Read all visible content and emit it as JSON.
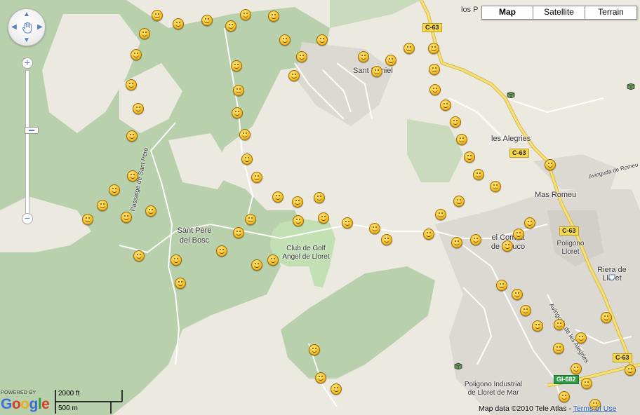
{
  "map_type": {
    "buttons": [
      {
        "label": "Map",
        "active": true
      },
      {
        "label": "Satellite",
        "active": false
      },
      {
        "label": "Terrain",
        "active": false
      }
    ]
  },
  "controls": {
    "zoom_in": "+",
    "zoom_out": "−",
    "pan": {
      "up": "▲",
      "down": "▼",
      "left": "◀",
      "right": "▶"
    }
  },
  "places": {
    "los_p": "los P",
    "sant_daniel": "Sant Daniel",
    "les_alegries": "les Alegries",
    "mas_romeu": "Mas Romeu",
    "sant_pere_1": "Sant Pere",
    "sant_pere_2": "del Bosc",
    "golf_1": "Club de Golf",
    "golf_2": "Angel de Lloret",
    "comtat_1": "el Comtat",
    "comtat_2": "de Jaruco",
    "poligono_lloret_1": "Poligono",
    "poligono_lloret_2": "Lloret",
    "riera_1": "Riera de",
    "riera_2": "Lloret",
    "poligono_ind_1": "Poligono Industrial",
    "poligono_ind_2": "de Lloret de Mar",
    "passatge": "Passatge de Sant Pere",
    "avinguda_romeu": "Avinguda de Romeu",
    "avinguda_alegries": "Avinguda de les Alegries"
  },
  "roads": {
    "c63": "C-63",
    "gi682": "GI-682"
  },
  "branding": {
    "powered_by": "POWERED BY",
    "logo": "Google"
  },
  "scale": {
    "imperial": "2000 ft",
    "metric": "500 m"
  },
  "footer": {
    "attribution": "Map data ©2010 Tele Atlas - ",
    "terms": "Terms of Use"
  },
  "colors": {
    "land": "#ece9e1",
    "forest": "#b8d0ac",
    "urban": "#dcd9d2",
    "golf": "#c2e0b4",
    "highway": "#f6e07a",
    "marker": "#f6c22a"
  }
}
